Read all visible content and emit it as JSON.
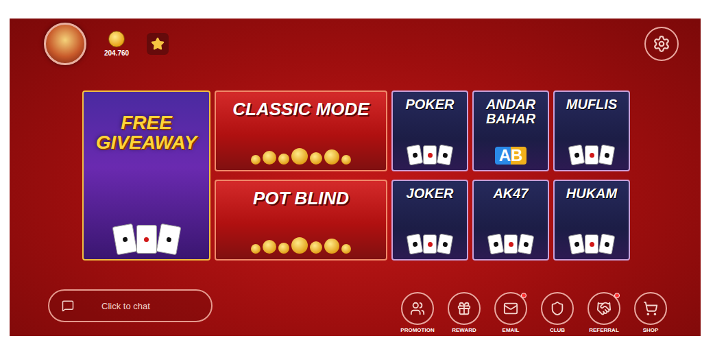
{
  "profile": {
    "balance": "204.760"
  },
  "games": [
    {
      "title": "FREE GIVEAWAY",
      "kind": "feature"
    },
    {
      "title": "CLASSIC MODE",
      "kind": "mode"
    },
    {
      "title": "POKER",
      "kind": "game"
    },
    {
      "title": "ANDAR BAHAR",
      "kind": "game",
      "badge": "AB"
    },
    {
      "title": "MUFLIS",
      "kind": "game"
    },
    {
      "title": "POT BLIND",
      "kind": "mode"
    },
    {
      "title": "JOKER",
      "kind": "game"
    },
    {
      "title": "AK47",
      "kind": "game"
    },
    {
      "title": "HUKAM",
      "kind": "game"
    }
  ],
  "chat": {
    "placeholder": "Click to chat"
  },
  "nav": [
    {
      "label": "PROMOTION",
      "badge": false
    },
    {
      "label": "REWARD",
      "badge": false
    },
    {
      "label": "EMAIL",
      "badge": true
    },
    {
      "label": "CLUB",
      "badge": false
    },
    {
      "label": "REFERRAL",
      "badge": true
    },
    {
      "label": "SHOP",
      "badge": false
    }
  ]
}
